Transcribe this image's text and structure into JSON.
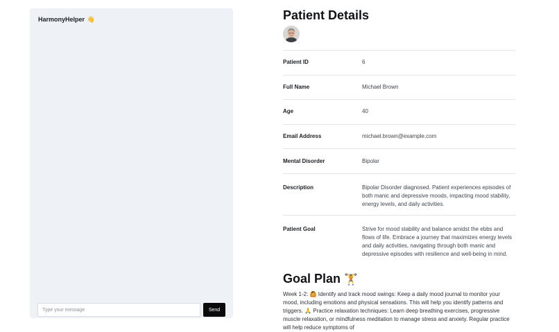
{
  "chat": {
    "title": "HarmonyHelper",
    "title_emoji": "👋",
    "input_placeholder": "Type your message",
    "send_label": "Send"
  },
  "details": {
    "title": "Patient Details",
    "rows": [
      {
        "label": "Patient ID",
        "value": "6"
      },
      {
        "label": "Full Name",
        "value": "Michael Brown"
      },
      {
        "label": "Age",
        "value": "40"
      },
      {
        "label": "Email Address",
        "value": "michael.brown@example.com"
      },
      {
        "label": "Mental Disorder",
        "value": "Bipolar"
      },
      {
        "label": "Description",
        "value": "Bipolar Disorder diagnosed. Patient experiences episodes of both manic and depressive moods, impacting mood stability, energy levels, and daily activities."
      },
      {
        "label": "Patient Goal",
        "value": "Strive for mood stability and balance amidst the ebbs and flows of life. Embrace a journey that maximizes energy levels and daily activities, navigating through both manic and depressive episodes with resilience and well-being in mind."
      }
    ]
  },
  "goal_plan": {
    "title": "Goal Plan",
    "title_emoji": "🏋️",
    "text": "Week 1-2: 🙆 Identify and track mood swings: Keep a daily mood journal to monitor your mood, including emotions and physical sensations. This will help you identify patterns and triggers. 🙏 Practice relaxation techniques: Learn deep breathing exercises, progressive muscle relaxation, or mindfulness meditation to manage stress and anxiety. Regular practice will help reduce symptoms of"
  }
}
